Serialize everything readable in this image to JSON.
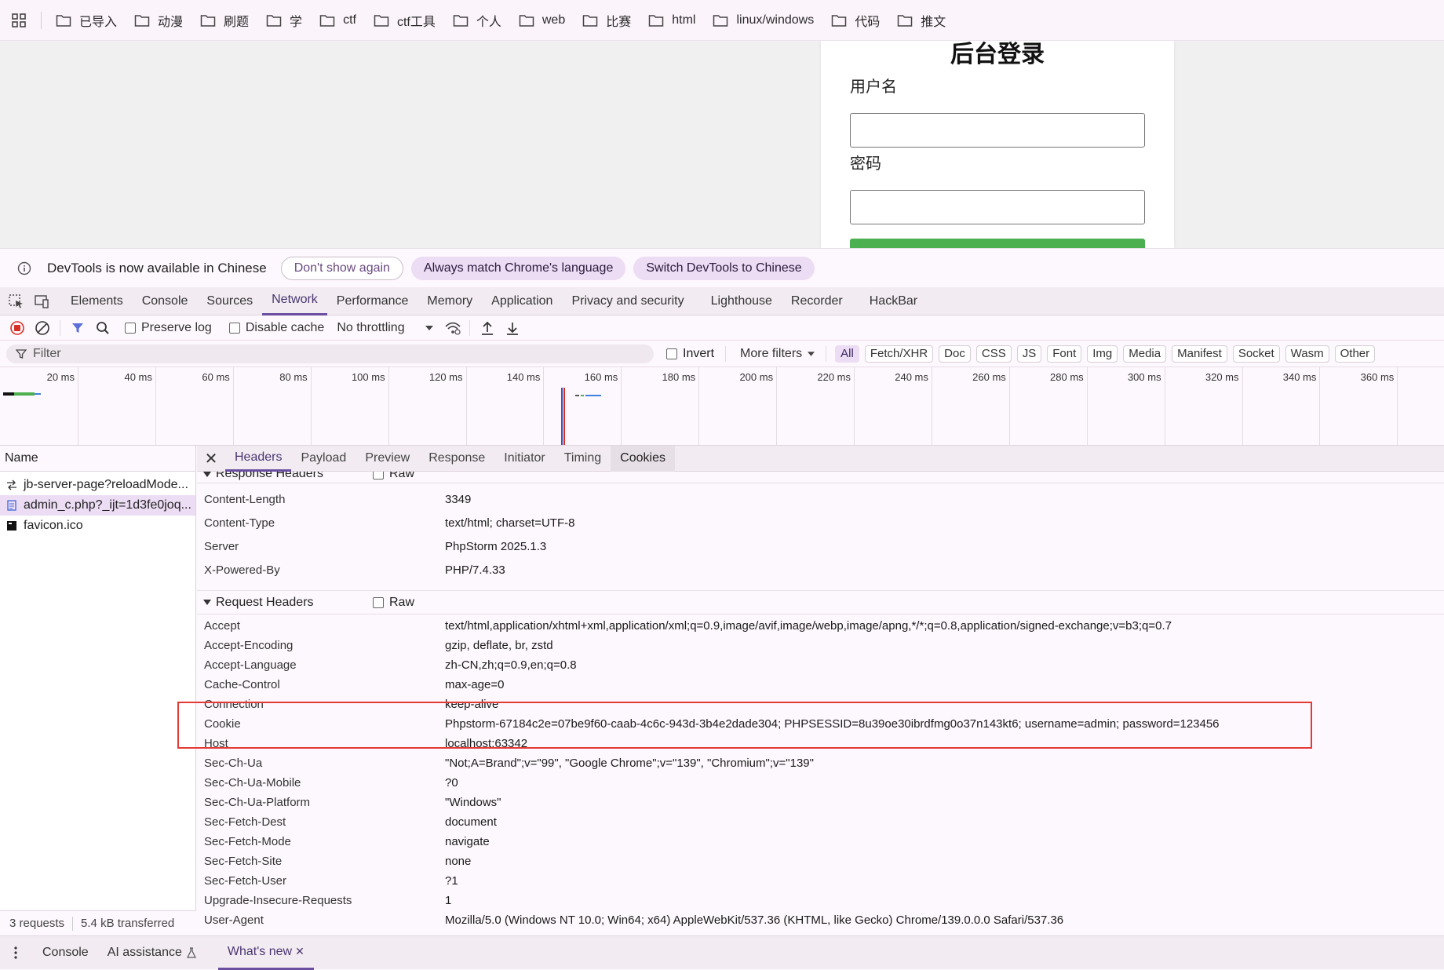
{
  "bookmarks": [
    "已导入",
    "动漫",
    "刷题",
    "学",
    "ctf",
    "ctf工具",
    "个人",
    "web",
    "比赛",
    "html",
    "linux/windows",
    "代码",
    "推文"
  ],
  "page": {
    "title": "后台登录",
    "username_label": "用户名",
    "password_label": "密码"
  },
  "banner": {
    "message": "DevTools is now available in Chinese",
    "dont_show": "Don't show again",
    "always_match": "Always match Chrome's language",
    "switch": "Switch DevTools to Chinese"
  },
  "devtools_tabs": [
    "Elements",
    "Console",
    "Sources",
    "Network",
    "Performance",
    "Memory",
    "Application",
    "Privacy and security",
    "Lighthouse",
    "Recorder",
    "HackBar"
  ],
  "toolbar": {
    "preserve_log": "Preserve log",
    "disable_cache": "Disable cache",
    "throttling": "No throttling"
  },
  "filter": {
    "placeholder": "Filter",
    "invert": "Invert",
    "more_filters": "More filters",
    "types": [
      "All",
      "Fetch/XHR",
      "Doc",
      "CSS",
      "JS",
      "Font",
      "Img",
      "Media",
      "Manifest",
      "Socket",
      "Wasm",
      "Other"
    ]
  },
  "timeline": {
    "ticks": [
      "20 ms",
      "40 ms",
      "60 ms",
      "80 ms",
      "100 ms",
      "120 ms",
      "140 ms",
      "160 ms",
      "180 ms",
      "200 ms",
      "220 ms",
      "240 ms",
      "260 ms",
      "280 ms",
      "300 ms",
      "320 ms",
      "340 ms",
      "360 ms"
    ]
  },
  "requests": {
    "header": "Name",
    "items": [
      "jb-server-page?reloadMode...",
      "admin_c.php?_ijt=1d3fe0joq...",
      "favicon.ico"
    ],
    "footer_requests": "3 requests",
    "footer_transferred": "5.4 kB transferred"
  },
  "detail_tabs": [
    "Headers",
    "Payload",
    "Preview",
    "Response",
    "Initiator",
    "Timing",
    "Cookies"
  ],
  "response_headers": {
    "title": "Response Headers",
    "raw": "Raw",
    "rows": [
      {
        "k": "Content-Length",
        "v": "3349"
      },
      {
        "k": "Content-Type",
        "v": "text/html; charset=UTF-8"
      },
      {
        "k": "Server",
        "v": "PhpStorm 2025.1.3"
      },
      {
        "k": "X-Powered-By",
        "v": "PHP/7.4.33"
      }
    ]
  },
  "request_headers": {
    "title": "Request Headers",
    "raw": "Raw",
    "rows": [
      {
        "k": "Accept",
        "v": "text/html,application/xhtml+xml,application/xml;q=0.9,image/avif,image/webp,image/apng,*/*;q=0.8,application/signed-exchange;v=b3;q=0.7"
      },
      {
        "k": "Accept-Encoding",
        "v": "gzip, deflate, br, zstd"
      },
      {
        "k": "Accept-Language",
        "v": "zh-CN,zh;q=0.9,en;q=0.8"
      },
      {
        "k": "Cache-Control",
        "v": "max-age=0"
      },
      {
        "k": "Connection",
        "v": "keep-alive"
      },
      {
        "k": "Cookie",
        "v": "Phpstorm-67184c2e=07be9f60-caab-4c6c-943d-3b4e2dade304; PHPSESSID=8u39oe30ibrdfmg0o37n143kt6; username=admin; password=123456"
      },
      {
        "k": "Host",
        "v": "localhost:63342"
      },
      {
        "k": "Sec-Ch-Ua",
        "v": "\"Not;A=Brand\";v=\"99\", \"Google Chrome\";v=\"139\", \"Chromium\";v=\"139\""
      },
      {
        "k": "Sec-Ch-Ua-Mobile",
        "v": "?0"
      },
      {
        "k": "Sec-Ch-Ua-Platform",
        "v": "\"Windows\""
      },
      {
        "k": "Sec-Fetch-Dest",
        "v": "document"
      },
      {
        "k": "Sec-Fetch-Mode",
        "v": "navigate"
      },
      {
        "k": "Sec-Fetch-Site",
        "v": "none"
      },
      {
        "k": "Sec-Fetch-User",
        "v": "?1"
      },
      {
        "k": "Upgrade-Insecure-Requests",
        "v": "1"
      },
      {
        "k": "User-Agent",
        "v": "Mozilla/5.0 (Windows NT 10.0; Win64; x64) AppleWebKit/537.36 (KHTML, like Gecko) Chrome/139.0.0.0 Safari/537.36"
      }
    ]
  },
  "drawer": {
    "console": "Console",
    "ai": "AI assistance",
    "whats_new": "What's new"
  },
  "colors": {
    "accent": "#6b4ea0",
    "highlight": "#e53935",
    "login_button": "#4caf50"
  }
}
